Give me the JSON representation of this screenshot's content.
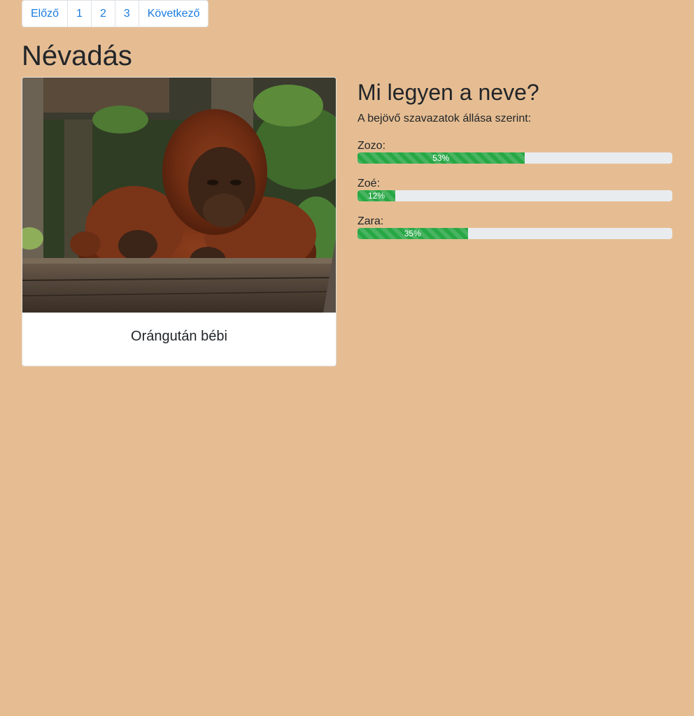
{
  "pagination": {
    "prev": "Előző",
    "pages": [
      "1",
      "2",
      "3"
    ],
    "next": "Következő"
  },
  "page_title": "Névadás",
  "card": {
    "caption": "Orángután bébi"
  },
  "poll": {
    "title": "Mi legyen a neve?",
    "subtitle": "A bejövő szavazatok állása szerint:",
    "options": [
      {
        "label": "Zozo:",
        "percent": 53,
        "percent_label": "53%"
      },
      {
        "label": "Zoé:",
        "percent": 12,
        "percent_label": "12%"
      },
      {
        "label": "Zara:",
        "percent": 35,
        "percent_label": "35%"
      }
    ]
  },
  "colors": {
    "background": "#e6bd92",
    "link": "#1a7de0",
    "progress_bar": "#28a745",
    "progress_track": "#e9ecef"
  }
}
